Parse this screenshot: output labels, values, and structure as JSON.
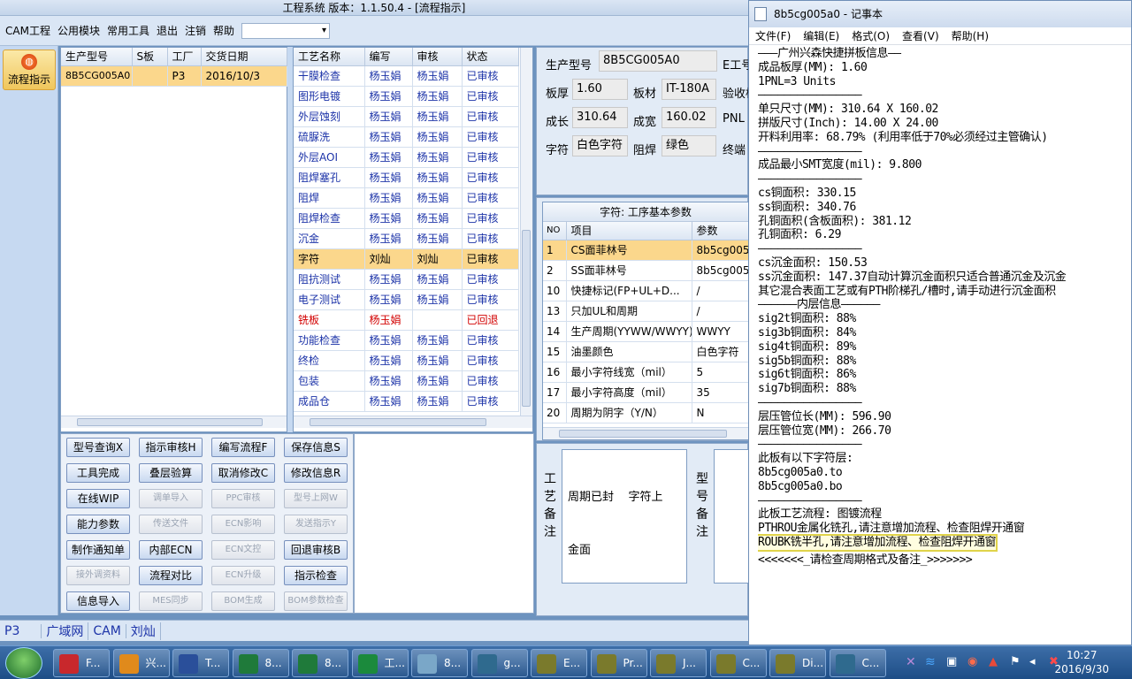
{
  "app": {
    "title": "工程系统  版本：1.1.50.4 - [流程指示]",
    "menus": [
      "CAM工程",
      "公用模块",
      "常用工具",
      "退出",
      "注销",
      "帮助"
    ],
    "menu_combo_value": "",
    "flow_button_label": "流程指示"
  },
  "orders": {
    "headers": [
      "生产型号",
      "S板",
      "工厂",
      "交货日期"
    ],
    "rows": [
      {
        "model": "8B5CG005A0",
        "s_board": "",
        "factory": "P3",
        "delivery": "2016/10/3"
      }
    ]
  },
  "process": {
    "headers": [
      "工艺名称",
      "编写",
      "审核",
      "状态"
    ],
    "rows": [
      {
        "name": "干膜检查",
        "writer": "杨玉娟",
        "reviewer": "杨玉娟",
        "status": "已审核"
      },
      {
        "name": "图形电镀",
        "writer": "杨玉娟",
        "reviewer": "杨玉娟",
        "status": "已审核"
      },
      {
        "name": "外层蚀刻",
        "writer": "杨玉娟",
        "reviewer": "杨玉娟",
        "status": "已审核"
      },
      {
        "name": "硫脲洗",
        "writer": "杨玉娟",
        "reviewer": "杨玉娟",
        "status": "已审核"
      },
      {
        "name": "外层AOI",
        "writer": "杨玉娟",
        "reviewer": "杨玉娟",
        "status": "已审核"
      },
      {
        "name": "阻焊塞孔",
        "writer": "杨玉娟",
        "reviewer": "杨玉娟",
        "status": "已审核"
      },
      {
        "name": "阻焊",
        "writer": "杨玉娟",
        "reviewer": "杨玉娟",
        "status": "已审核"
      },
      {
        "name": "阻焊检查",
        "writer": "杨玉娟",
        "reviewer": "杨玉娟",
        "status": "已审核"
      },
      {
        "name": "沉金",
        "writer": "杨玉娟",
        "reviewer": "杨玉娟",
        "status": "已审核"
      },
      {
        "name": "字符",
        "writer": "刘灿",
        "reviewer": "刘灿",
        "status": "已审核"
      },
      {
        "name": "阻抗测试",
        "writer": "杨玉娟",
        "reviewer": "杨玉娟",
        "status": "已审核"
      },
      {
        "name": "电子测试",
        "writer": "杨玉娟",
        "reviewer": "杨玉娟",
        "status": "已审核"
      },
      {
        "name": "铣板",
        "writer": "杨玉娟",
        "reviewer": "",
        "status": "已回退"
      },
      {
        "name": "功能检查",
        "writer": "杨玉娟",
        "reviewer": "杨玉娟",
        "status": "已审核"
      },
      {
        "name": "终检",
        "writer": "杨玉娟",
        "reviewer": "杨玉娟",
        "status": "已审核"
      },
      {
        "name": "包装",
        "writer": "杨玉娟",
        "reviewer": "杨玉娟",
        "status": "已审核"
      },
      {
        "name": "成品仓",
        "writer": "杨玉娟",
        "reviewer": "杨玉娟",
        "status": "已审核"
      }
    ]
  },
  "buttons": [
    [
      {
        "label": "型号查询X",
        "enabled": true
      },
      {
        "label": "指示审核H",
        "enabled": true
      },
      {
        "label": "编写流程F",
        "enabled": true
      },
      {
        "label": "保存信息S",
        "enabled": true
      }
    ],
    [
      {
        "label": "工具完成",
        "enabled": true
      },
      {
        "label": "叠层验算",
        "enabled": true
      },
      {
        "label": "取消修改C",
        "enabled": true
      },
      {
        "label": "修改信息R",
        "enabled": true
      }
    ],
    [
      {
        "label": "在线WIP",
        "enabled": true
      },
      {
        "label": "调单导入",
        "enabled": false
      },
      {
        "label": "PPC审核",
        "enabled": false
      },
      {
        "label": "型号上网W",
        "enabled": false
      }
    ],
    [
      {
        "label": "能力参数",
        "enabled": true
      },
      {
        "label": "传送文件",
        "enabled": false
      },
      {
        "label": "ECN影响",
        "enabled": false
      },
      {
        "label": "发送指示Y",
        "enabled": false
      }
    ],
    [
      {
        "label": "制作通知单",
        "enabled": true
      },
      {
        "label": "内部ECN",
        "enabled": true
      },
      {
        "label": "ECN文控",
        "enabled": false
      },
      {
        "label": "回退审核B",
        "enabled": true
      }
    ],
    [
      {
        "label": "接外调资料",
        "enabled": false
      },
      {
        "label": "流程对比",
        "enabled": true
      },
      {
        "label": "ECN升级",
        "enabled": false
      },
      {
        "label": "指示检查",
        "enabled": true
      }
    ],
    [
      {
        "label": "信息导入",
        "enabled": true
      },
      {
        "label": "MES同步",
        "enabled": false
      },
      {
        "label": "BOM生成",
        "enabled": false
      },
      {
        "label": "BOM参数检查",
        "enabled": false
      }
    ]
  ],
  "info": {
    "model_label": "生产型号",
    "model_value": "8B5CG005A0",
    "e_label": "E工号",
    "thickness_label": "板厚",
    "thickness_value": "1.60",
    "material_label": "板材",
    "material_value": "IT-180A",
    "accept_label": "验收标",
    "length_label": "成长",
    "length_value": "310.64",
    "width_label": "成宽",
    "width_value": "160.02",
    "pnl_label": "PNL",
    "char_label": "字符",
    "char_value": "白色字符",
    "mask_label": "阻焊",
    "mask_value": "绿色",
    "terminal_label": "终端"
  },
  "params": {
    "title": "字符: 工序基本参数",
    "headers": [
      "NO",
      "项目",
      "参数"
    ],
    "rows": [
      {
        "no": "1",
        "item": "CS面菲林号",
        "value": "8b5cg005a"
      },
      {
        "no": "2",
        "item": "SS面菲林号",
        "value": "8b5cg005a"
      },
      {
        "no": "10",
        "item": "快捷标记(FP+UL+D...",
        "value": "/"
      },
      {
        "no": "13",
        "item": "只加UL和周期",
        "value": "/"
      },
      {
        "no": "14",
        "item": "生产周期(YYWW/WWYY)",
        "value": "WWYY"
      },
      {
        "no": "15",
        "item": "油墨颜色",
        "value": "白色字符"
      },
      {
        "no": "16",
        "item": "最小字符线宽（mil）",
        "value": "5"
      },
      {
        "no": "17",
        "item": "最小字符高度（mil）",
        "value": "35"
      },
      {
        "no": "20",
        "item": "周期为阴字（Y/N）",
        "value": "N"
      }
    ]
  },
  "remarks": {
    "process_remark_label": "工艺备注",
    "line1": "周期已封    字符上",
    "line2": "金面",
    "model_remark_label": "型号备注"
  },
  "statusbar": [
    "P3",
    "广域网",
    "CAM",
    "刘灿"
  ],
  "notepad": {
    "title": "8b5cg005a0 - 记事本",
    "menus": [
      "文件(F)",
      "编辑(E)",
      "格式(O)",
      "查看(V)",
      "帮助(H)"
    ],
    "lines": [
      "———广州兴森快捷拼板信息——",
      "成品板厚(MM): 1.60",
      "1PNL=3 Units",
      "————————————————",
      "单只尺寸(MM): 310.64 X 160.02",
      "拼版尺寸(Inch): 14.00 X 24.00",
      "开料利用率: 68.79% (利用率低于70%必须经过主管确认)",
      "————————————————",
      "成品最小SMT宽度(mil): 9.800",
      "————————————————",
      "cs铜面积: 330.15",
      "ss铜面积: 340.76",
      "孔铜面积(含板面积): 381.12",
      "孔铜面积: 6.29",
      "————————————————",
      "cs沉金面积: 150.53",
      "ss沉金面积: 147.37自动计算沉金面积只适合普通沉金及沉金",
      "其它混合表面工艺或有PTH阶梯孔/槽时,请手动进行沉金面积",
      "——————内层信息——————",
      "sig2t铜面积: 88%",
      "sig3b铜面积: 84%",
      "sig4t铜面积: 89%",
      "sig5b铜面积: 88%",
      "sig6t铜面积: 86%",
      "sig7b铜面积: 88%",
      "————————————————",
      "层压管位长(MM): 596.90",
      "层压管位宽(MM): 266.70",
      "————————————————",
      "此板有以下字符层:",
      "8b5cg005a0.to",
      "8b5cg005a0.bo",
      "————————————————",
      "此板工艺流程: 图镀流程",
      "PTHROU金属化铣孔,请注意增加流程、检查阻焊开通窗",
      "ROUBK铣半孔,请注意增加流程、检查阻焊开通窗",
      "<<<<<<<_请检查周期格式及备注_>>>>>>>"
    ],
    "highlight_line": 35
  },
  "taskbar": {
    "items": [
      {
        "label": "F...",
        "icon_color": "#c8282c"
      },
      {
        "label": "兴...",
        "icon_color": "#e08a1c"
      },
      {
        "label": "T...",
        "icon_color": "#2a4f9a"
      },
      {
        "label": "8...",
        "icon_color": "#1f7a3a"
      },
      {
        "label": "8...",
        "icon_color": "#1f7a3a"
      },
      {
        "label": "工...",
        "icon_color": "#1b8a3c"
      },
      {
        "label": "8...",
        "icon_color": "#7aa7c8"
      },
      {
        "label": "g...",
        "icon_color": "#2f6a8e"
      },
      {
        "label": "E...",
        "icon_color": "#7a7a2c"
      },
      {
        "label": "Pr...",
        "icon_color": "#7a7a2c"
      },
      {
        "label": "J...",
        "icon_color": "#7a7a2c"
      },
      {
        "label": "C...",
        "icon_color": "#7a7a2c"
      },
      {
        "label": "Di...",
        "icon_color": "#7a7a2c"
      },
      {
        "label": "C...",
        "icon_color": "#2f6a8e"
      }
    ],
    "time": "10:27",
    "date": "2016/9/30"
  }
}
